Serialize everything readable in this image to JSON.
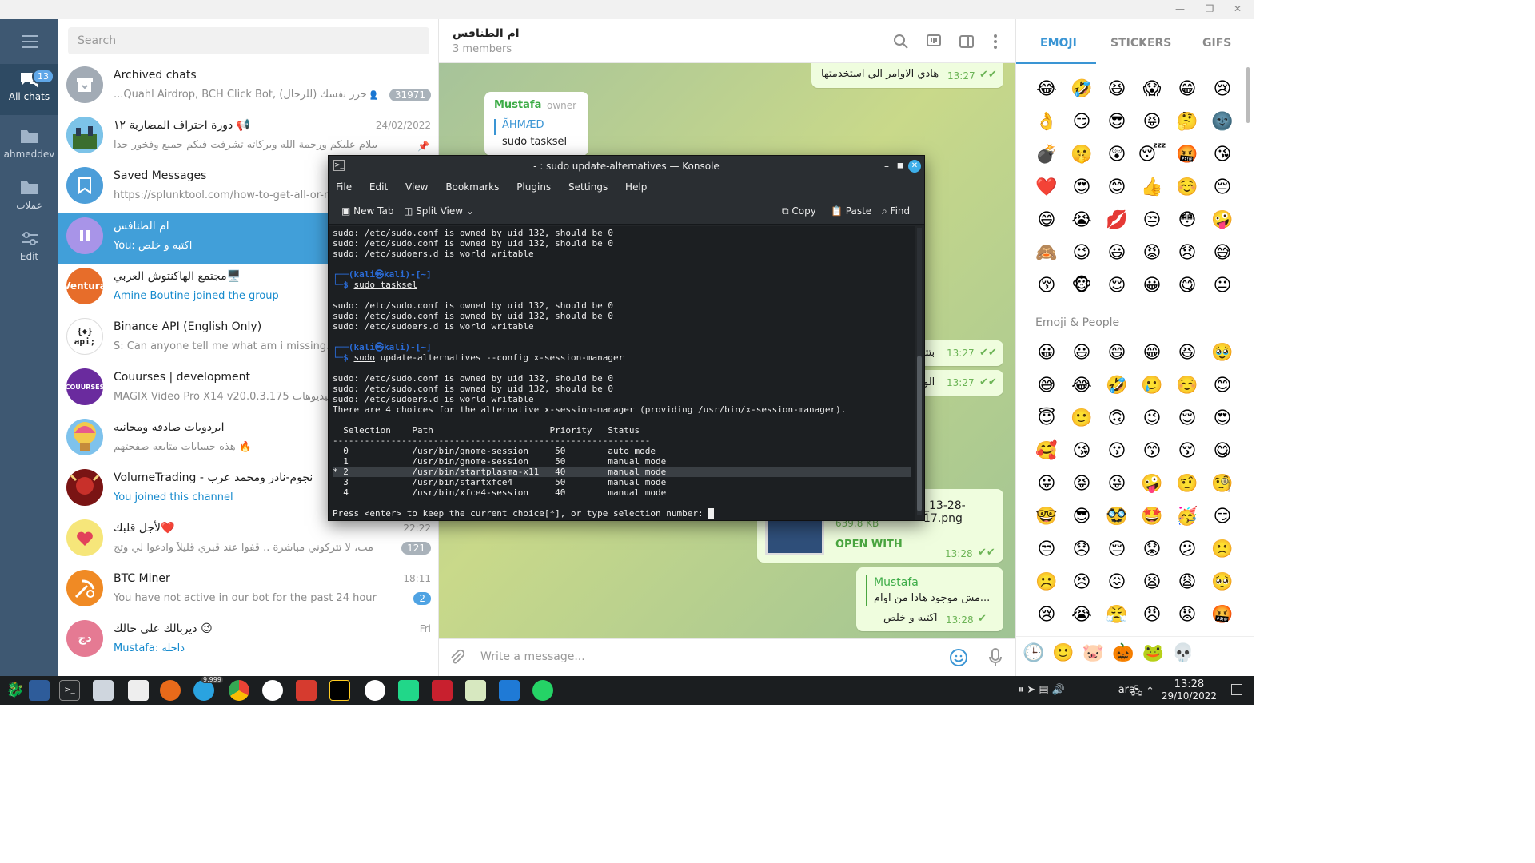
{
  "rail": {
    "folders": [
      {
        "label": "All chats",
        "badge": "13"
      },
      {
        "label": "ahmeddev"
      },
      {
        "label": "عملات"
      },
      {
        "label": "Edit"
      }
    ]
  },
  "search": {
    "placeholder": "Search"
  },
  "chats": [
    {
      "title": "Archived chats",
      "preview": "...Quahl Airdrop, BCH Click Bot, حرر نفسك (للرجال) 👥",
      "count": "31971"
    },
    {
      "title": "دورة احتراف المضاربة ١٢ 📢",
      "preview": "السلام عليكم ورحمة الله وبركاته   تشرفت فيكم جميع وفخور جداً...",
      "time": "24/02/2022"
    },
    {
      "title": "Saved Messages",
      "preview": "https://splunktool.com/how-to-get-all-or-mu"
    },
    {
      "title": "ام الطنافس",
      "preview": "You: اكتبه و خلص"
    },
    {
      "title": "مجتمع الهاكنتوش العربي🖥️",
      "preview": "Amine Boutine joined the group"
    },
    {
      "title": "Binance API (English Only)",
      "preview": "S: Can anyone tell me what am i missing. I ar"
    },
    {
      "title": "Couurses | development",
      "preview": "MAGIX Video Pro X14 v20.0.3.175  الفيديوهات"
    },
    {
      "title": "ايردويات صادقه ومجانيه",
      "preview": "هذه حسابات متابعه صفحتهم 🔥"
    },
    {
      "title": "VolumeTrading - نجوم-نادر ومحمد عرب",
      "preview": "You joined this channel"
    },
    {
      "title": "لأجل قلبك❤️",
      "preview": "أنا إن مت، لا تتركوني مباشرة .. قفوا عند قبري قليلاً وادعوا لي وتج...",
      "time": "22:22",
      "count": "121"
    },
    {
      "title": "BTC Miner",
      "preview": "You have not active in our bot for the past 24 hours, theref...",
      "time": "18:11",
      "count": "2"
    },
    {
      "title": "ديربالك على حالك 😉",
      "preview": "Mustafa: داخله",
      "time": "Fri"
    }
  ],
  "avatars": {
    "ventura": "Ventura",
    "api": "{◆}\napi;",
    "dj": "دج",
    "courses": "COUURSES"
  },
  "chat": {
    "name": "ام الطنافس",
    "members": "3 members",
    "messages": [
      {
        "text": "هادي الاوامر الي استخدمتها",
        "time": "13:27"
      },
      {
        "author": "Mustafa",
        "role": "owner",
        "reply_to": "ÃHMÆD",
        "text": "sudo tasksel"
      },
      {
        "text": "بتتو",
        "time": "13:27"
      },
      {
        "text": "الو",
        "time": "13:27"
      },
      {
        "file": "_13-28-17.png",
        "size": "639.8 KB",
        "action": "OPEN WITH",
        "time": "13:28"
      },
      {
        "author": "Mustafa",
        "quote": "مش موجود هاذا من اوام...",
        "text": "اكتبه و خلص",
        "time": "13:28"
      }
    ],
    "composer_placeholder": "Write a message..."
  },
  "emoji_panel": {
    "tabs": [
      "EMOJI",
      "STICKERS",
      "GIFS"
    ],
    "recent": [
      "😂",
      "🤣",
      "😆",
      "😱",
      "😁",
      "😢",
      "👌",
      "😏",
      "😎",
      "😝",
      "🤔",
      "🌚",
      "💣",
      "🤫",
      "😲",
      "😴",
      "🤬",
      "😘",
      "❤️",
      "😍",
      "😊",
      "👍",
      "☺️",
      "😔",
      "😄",
      "😭",
      "💋",
      "😒",
      "😳",
      "🤪",
      "🙈",
      "😉",
      "😃",
      "😡",
      "😞",
      "😅",
      "😚",
      "🐵",
      "😌",
      "😀",
      "😋",
      "😐"
    ],
    "section": "Emoji & People",
    "people": [
      "😀",
      "😃",
      "😄",
      "😁",
      "😆",
      "🥹",
      "😅",
      "😂",
      "🤣",
      "🥲",
      "☺️",
      "😊",
      "😇",
      "🙂",
      "🙃",
      "😉",
      "😌",
      "😍",
      "🥰",
      "😘",
      "😗",
      "😙",
      "😚",
      "😋",
      "😛",
      "😝",
      "😜",
      "🤪",
      "🤨",
      "🧐",
      "🤓",
      "😎",
      "🥸",
      "🤩",
      "🥳",
      "😏",
      "😒",
      "😞",
      "😔",
      "😟",
      "😕",
      "🙁",
      "☹️",
      "😣",
      "😖",
      "😫",
      "😩",
      "🥺",
      "😢",
      "😭",
      "😤",
      "😠",
      "😡",
      "🤬"
    ],
    "bottom": [
      "🕒",
      "🙂",
      "🐷",
      "🎃",
      "🐸",
      "💀"
    ]
  },
  "konsole": {
    "title": "- : sudo update-alternatives — Konsole",
    "menu": [
      "File",
      "Edit",
      "View",
      "Bookmarks",
      "Plugins",
      "Settings",
      "Help"
    ],
    "toolbar": {
      "new_tab": "New Tab",
      "split_view": "Split View",
      "copy": "Copy",
      "paste": "Paste",
      "find": "Find"
    },
    "lines": [
      "sudo: /etc/sudo.conf is owned by uid 132, should be 0",
      "sudo: /etc/sudo.conf is owned by uid 132, should be 0",
      "sudo: /etc/sudoers.d is world writable"
    ],
    "prompt_user": "┌──(kali㉿kali)-[~]",
    "prompt_tail": "└─$ ",
    "cmd1": "sudo tasksel",
    "cmd2_sudo": "sudo",
    "cmd2_rest": " update-alternatives --config x-session-manager",
    "choices_line": "There are 4 choices for the alternative x-session-manager (providing /usr/bin/x-session-manager).",
    "table_header": "  Selection    Path                      Priority   Status",
    "table_sep": "------------------------------------------------------------",
    "rows": [
      "  0            /usr/bin/gnome-session     50        auto mode",
      "  1            /usr/bin/gnome-session     50        manual mode",
      "* 2            /usr/bin/startplasma-x11   40        manual mode",
      "  3            /usr/bin/startxfce4        50        manual mode",
      "  4            /usr/bin/xfce4-session     40        manual mode"
    ],
    "press": "Press <enter> to keep the current choice[*], or type selection number: "
  },
  "taskbar": {
    "lang": "ara",
    "time": "13:28",
    "date": "29/10/2022",
    "telegram_badge": "9,999"
  },
  "colors": {
    "accent": "#419fd9",
    "rail": "#3e5872",
    "chat_bg": "#a6c39a",
    "term_bg": "#1c1f22"
  }
}
